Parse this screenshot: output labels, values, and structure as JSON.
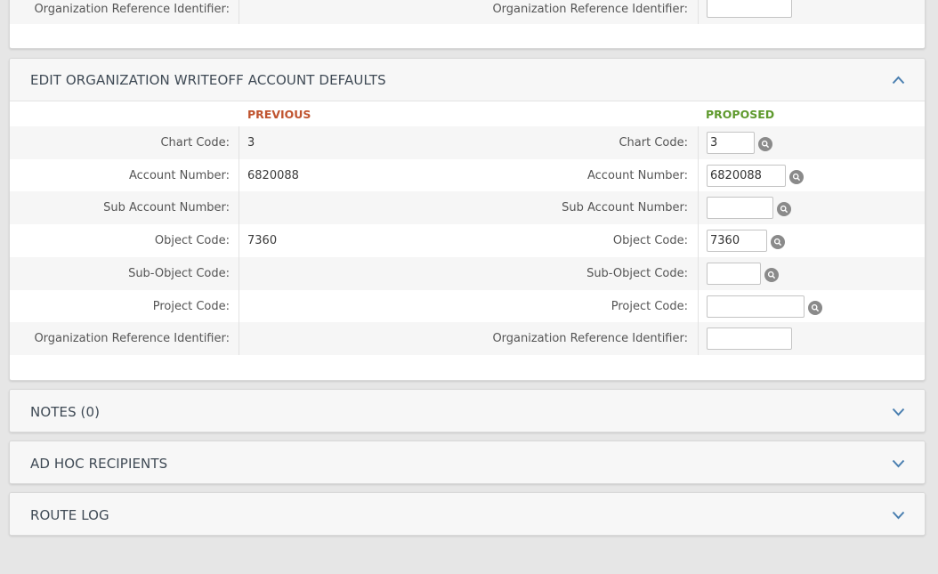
{
  "colors": {
    "previous": "#c0542f",
    "proposed": "#5f9a2e",
    "background": "#e6e6e6"
  },
  "top_section": {
    "left_label": "Organization Reference Identifier:",
    "right_label": "Organization Reference Identifier:",
    "right_value": ""
  },
  "writeoff_section": {
    "title": "EDIT ORGANIZATION WRITEOFF ACCOUNT DEFAULTS",
    "toggle_icon": "chevron-up-icon",
    "previous_header": "PREVIOUS",
    "proposed_header": "PROPOSED",
    "rows": [
      {
        "label": "Chart Code:",
        "previous": "3",
        "proposed_label": "Chart Code:",
        "proposed": "3",
        "lookup": true
      },
      {
        "label": "Account Number:",
        "previous": "6820088",
        "proposed_label": "Account Number:",
        "proposed": "6820088",
        "lookup": true
      },
      {
        "label": "Sub Account Number:",
        "previous": "",
        "proposed_label": "Sub Account Number:",
        "proposed": "",
        "lookup": true
      },
      {
        "label": "Object Code:",
        "previous": "7360",
        "proposed_label": "Object Code:",
        "proposed": "7360",
        "lookup": true
      },
      {
        "label": "Sub-Object Code:",
        "previous": "",
        "proposed_label": "Sub-Object Code:",
        "proposed": "",
        "lookup": true
      },
      {
        "label": "Project Code:",
        "previous": "",
        "proposed_label": "Project Code:",
        "proposed": "",
        "lookup": true
      },
      {
        "label": "Organization Reference Identifier:",
        "previous": "",
        "proposed_label": "Organization Reference Identifier:",
        "proposed": "",
        "lookup": false
      }
    ]
  },
  "collapsed_sections": [
    {
      "title": "NOTES (0)",
      "icon": "chevron-down-icon"
    },
    {
      "title": "AD HOC RECIPIENTS",
      "icon": "chevron-down-icon"
    },
    {
      "title": "ROUTE LOG",
      "icon": "chevron-down-icon"
    }
  ]
}
